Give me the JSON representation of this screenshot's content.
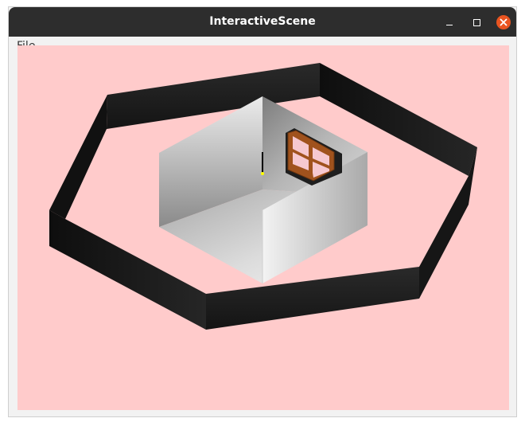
{
  "window": {
    "title": "InteractiveScene"
  },
  "menu": {
    "file_label": "File"
  },
  "colors": {
    "titlebar": "#2d2d2d",
    "close_button": "#e95420",
    "viewport_background": "#ffcbcb",
    "outer_wall": "#1a1a1a",
    "room_wall_light": "#f0f0f0",
    "room_wall_dark": "#8f8f8f",
    "window_frame": "#a0521d",
    "window_glass": "#f6c8d0",
    "pointer_marker": "#ffff00"
  },
  "icons": {
    "minimize": "minimize-icon",
    "maximize": "maximize-icon",
    "close": "close-icon"
  },
  "scene": {
    "outer_enclosure": "hexagonal-wall",
    "inner_structure": "open-room-with-window"
  }
}
